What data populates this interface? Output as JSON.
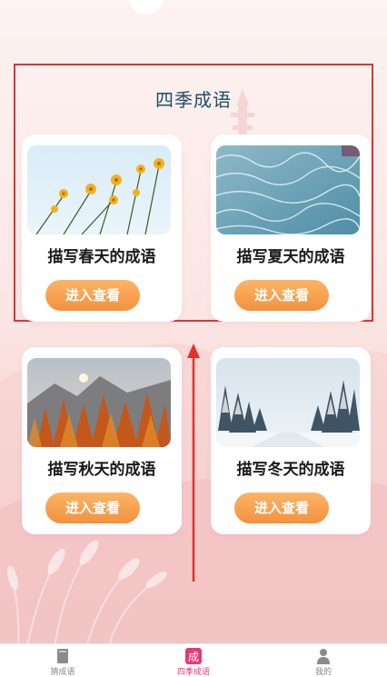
{
  "section": {
    "title": "四季成语"
  },
  "cards": [
    {
      "label": "描写春天的成语",
      "button": "进入查看",
      "image": "yellow-flowers"
    },
    {
      "label": "描写夏天的成语",
      "button": "进入查看",
      "image": "rippling-water"
    },
    {
      "label": "描写秋天的成语",
      "button": "进入查看",
      "image": "autumn-forest"
    },
    {
      "label": "描写冬天的成语",
      "button": "进入查看",
      "image": "snowy-road"
    }
  ],
  "tabbar": {
    "items": [
      {
        "label": "猜成语",
        "icon": "book-icon",
        "active": false
      },
      {
        "label": "四季成语",
        "icon": "idiom-badge-icon",
        "active": true,
        "badge_text": "成"
      },
      {
        "label": "我的",
        "icon": "person-icon",
        "active": false
      }
    ]
  },
  "colors": {
    "accent": "#e5397a",
    "button_top": "#fbb565",
    "button_bottom": "#f3913f",
    "title": "#1f4f66",
    "annotation": "#e53030"
  }
}
